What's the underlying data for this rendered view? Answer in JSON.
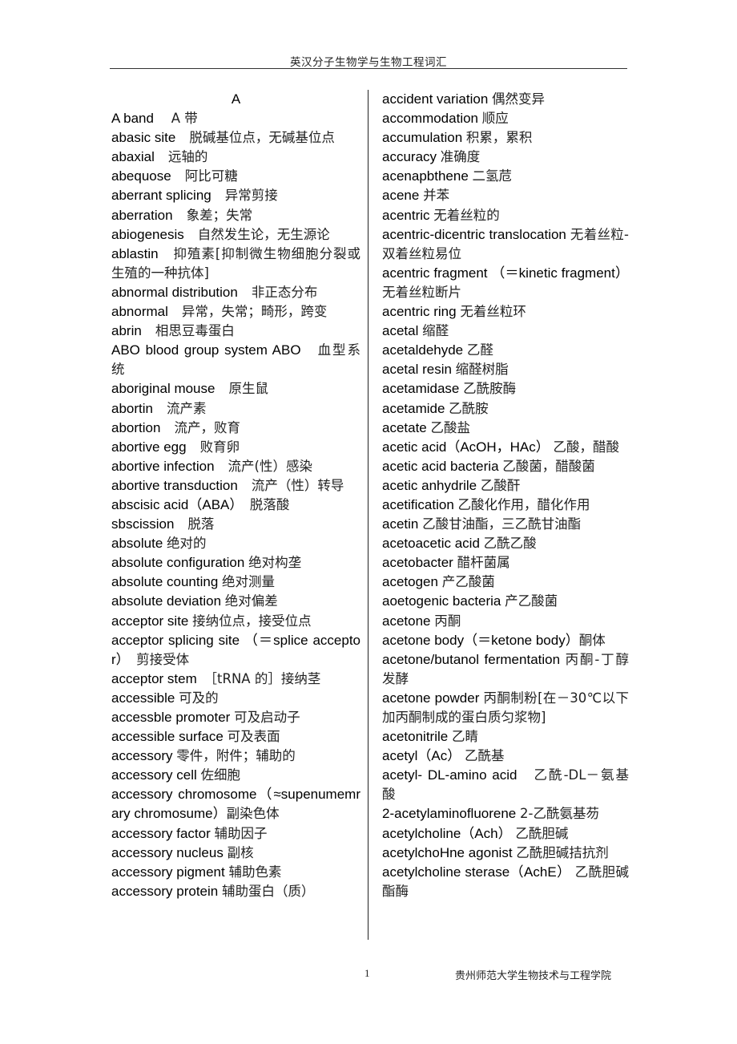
{
  "header": {
    "title": "英汉分子生物学与生物工程词汇"
  },
  "left_column": {
    "section_heading": "A",
    "entries": [
      {
        "term": "A band",
        "sep": "　 ",
        "zh": "A 带"
      },
      {
        "term": "abasic site",
        "sep": "　",
        "zh": "脱碱基位点，无碱基位点"
      },
      {
        "term": "abaxial",
        "sep": "　",
        "zh": "远轴的"
      },
      {
        "term": "abequose",
        "sep": "　",
        "zh": "阿比可糖"
      },
      {
        "term": "aberrant splicing",
        "sep": "　",
        "zh": "异常剪接"
      },
      {
        "term": "aberration",
        "sep": "　",
        "zh": "象差；失常"
      },
      {
        "term": "abiogenesis",
        "sep": "　",
        "zh": "自然发生论，无生源论"
      },
      {
        "term": "ablastin",
        "sep": "　",
        "zh": "抑殖素[抑制微生物细胞分裂或生殖的一种抗体]"
      },
      {
        "term": "abnormal distribution",
        "sep": "　",
        "zh": "非正态分布"
      },
      {
        "term": "abnormal",
        "sep": "　",
        "zh": "异常，失常；畸形，跨变"
      },
      {
        "term": "abrin",
        "sep": "　",
        "zh": "相思豆毒蛋白"
      },
      {
        "term": "ABO blood group system ABO",
        "sep": "　",
        "zh": "血型系统"
      },
      {
        "term": "aboriginal mouse",
        "sep": "　",
        "zh": "原生鼠"
      },
      {
        "term": "abortin",
        "sep": "　",
        "zh": "流产素"
      },
      {
        "term": "abortion",
        "sep": "　",
        "zh": "流产，败育"
      },
      {
        "term": "abortive egg",
        "sep": "　",
        "zh": "败育卵"
      },
      {
        "term": "abortive infection",
        "sep": "　",
        "zh": "流产(性）感染"
      },
      {
        "term": "abortive transduction",
        "sep": "　",
        "zh": "流产（性）转导"
      },
      {
        "term": "abscisic acid（ABA）",
        "sep": "　",
        "zh": "脱落酸"
      },
      {
        "term": "sbscission",
        "sep": "　",
        "zh": "脱落"
      },
      {
        "term": "absolute",
        "sep": " ",
        "zh": "绝对的"
      },
      {
        "term": "absolute configuration",
        "sep": " ",
        "zh": "绝对构垄"
      },
      {
        "term": "absolute counting",
        "sep": " ",
        "zh": "绝对测量"
      },
      {
        "term": "absolute deviation",
        "sep": " ",
        "zh": "绝对偏差"
      },
      {
        "term": "acceptor site",
        "sep": " ",
        "zh": "接纳位点，接受位点"
      },
      {
        "term": "acceptor splicing site （＝splice acceptor）",
        "sep": "　",
        "zh": "剪接受体"
      },
      {
        "term": "acceptor stem",
        "sep": "　",
        "zh": "［tRNA 的］接纳茎"
      },
      {
        "term": "accessible",
        "sep": " ",
        "zh": "可及的"
      },
      {
        "term": "accessble promoter",
        "sep": " ",
        "zh": "可及启动子"
      },
      {
        "term": "accessible surface",
        "sep": " ",
        "zh": "可及表面"
      },
      {
        "term": "accessory",
        "sep": " ",
        "zh": "零件，附件；辅助的"
      },
      {
        "term": "accessory cell",
        "sep": " ",
        "zh": "佐细胞"
      },
      {
        "term": "accessory chromosome（≈supenumemrary chromosume）",
        "sep": "",
        "zh": "副染色体"
      },
      {
        "term": "accessory factor",
        "sep": " ",
        "zh": "辅助因子"
      },
      {
        "term": "accessory nucleus",
        "sep": " ",
        "zh": "副核"
      },
      {
        "term": "accessory pigment",
        "sep": " ",
        "zh": "辅助色素"
      },
      {
        "term": "accessory protein",
        "sep": " ",
        "zh": "辅助蛋白（质）"
      }
    ]
  },
  "right_column": {
    "entries": [
      {
        "term": "accident variation",
        "sep": " ",
        "zh": "偶然变异"
      },
      {
        "term": "accommodation",
        "sep": " ",
        "zh": "顺应"
      },
      {
        "term": "accumulation",
        "sep": " ",
        "zh": "积累，累积"
      },
      {
        "term": "accuracy",
        "sep": " ",
        "zh": "准确度"
      },
      {
        "term": "acenapbthene",
        "sep": " ",
        "zh": "二氢苊"
      },
      {
        "term": "acene",
        "sep": " ",
        "zh": "并苯"
      },
      {
        "term": "acentric",
        "sep": " ",
        "zh": "无着丝粒的"
      },
      {
        "term": "acentric-dicentric translocation",
        "sep": " ",
        "zh": "无着丝粒-双着丝粒易位"
      },
      {
        "term": "acentric fragment （＝kinetic fragment）",
        "sep": " ",
        "zh": "无着丝粒断片"
      },
      {
        "term": "acentric ring",
        "sep": " ",
        "zh": "无着丝粒环"
      },
      {
        "term": "acetal",
        "sep": " ",
        "zh": "缩醛"
      },
      {
        "term": "acetaldehyde",
        "sep": " ",
        "zh": "乙醛"
      },
      {
        "term": "acetal resin",
        "sep": " ",
        "zh": "缩醛树脂"
      },
      {
        "term": "acetamidase",
        "sep": " ",
        "zh": "乙酰胺酶"
      },
      {
        "term": "acetamide",
        "sep": " ",
        "zh": "乙酰胺"
      },
      {
        "term": "acetate",
        "sep": " ",
        "zh": "乙酸盐"
      },
      {
        "term": "acetic acid（AcOH，HAc）",
        "sep": " ",
        "zh": "乙酸，醋酸"
      },
      {
        "term": "acetic acid bacteria",
        "sep": " ",
        "zh": "乙酸菌，醋酸菌"
      },
      {
        "term": "acetic anhydrile",
        "sep": " ",
        "zh": "乙酸酐"
      },
      {
        "term": "acetification",
        "sep": " ",
        "zh": "乙酸化作用，醋化作用"
      },
      {
        "term": "acetin",
        "sep": " ",
        "zh": "乙酸甘油酯，三乙酰甘油酯"
      },
      {
        "term": "acetoacetic acid",
        "sep": " ",
        "zh": "乙酰乙酸"
      },
      {
        "term": "acetobacter",
        "sep": " ",
        "zh": "醋杆菌属"
      },
      {
        "term": "acetogen",
        "sep": " ",
        "zh": "产乙酸菌"
      },
      {
        "term": "aoetogenic bacteria",
        "sep": " ",
        "zh": "产乙酸菌"
      },
      {
        "term": "acetone",
        "sep": " ",
        "zh": "丙酮"
      },
      {
        "term": "acetone body（＝ketone body）",
        "sep": "",
        "zh": "酮体"
      },
      {
        "term": "acetone/butanol fermentation",
        "sep": " ",
        "zh": "丙酮-丁醇发酵"
      },
      {
        "term": "acetone powder",
        "sep": " ",
        "zh": "丙酮制粉[在－30℃以下加丙酮制成的蛋白质匀浆物]"
      },
      {
        "term": "acetonitrile",
        "sep": " ",
        "zh": "乙睛"
      },
      {
        "term": "acetyl（Ac）",
        "sep": " ",
        "zh": "乙酰基"
      },
      {
        "term": "acetyl- DL-amino acid",
        "sep": "　",
        "zh": "乙酰-DL－氨基酸"
      },
      {
        "term": "2-acetylaminofluorene",
        "sep": " ",
        "zh": "2-乙酰氨基芴"
      },
      {
        "term": "acetylcholine（Ach）",
        "sep": " ",
        "zh": "乙酰胆碱"
      },
      {
        "term": "acetylchoHne agonist",
        "sep": " ",
        "zh": "乙酰胆碱拮抗剂"
      },
      {
        "term": "acetylcholine sterase（AchE）",
        "sep": " ",
        "zh": "乙酰胆碱酯酶"
      }
    ]
  },
  "footer": {
    "page_number": "1",
    "institution": "贵州师范大学生物技术与工程学院"
  }
}
